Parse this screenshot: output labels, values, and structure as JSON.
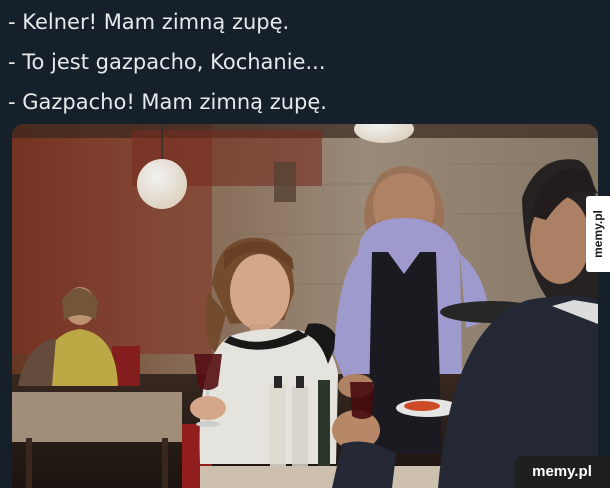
{
  "caption": {
    "lines": [
      "- Kelner! Mam zimną zupę.",
      "- To jest gazpacho, Kochanie...",
      "- Gazpacho! Mam zimną zupę."
    ]
  },
  "watermarks": {
    "side": "memy.pl",
    "corner": "memy.pl"
  },
  "colors": {
    "background": "#15202b",
    "caption_text": "#e7e9ea"
  }
}
